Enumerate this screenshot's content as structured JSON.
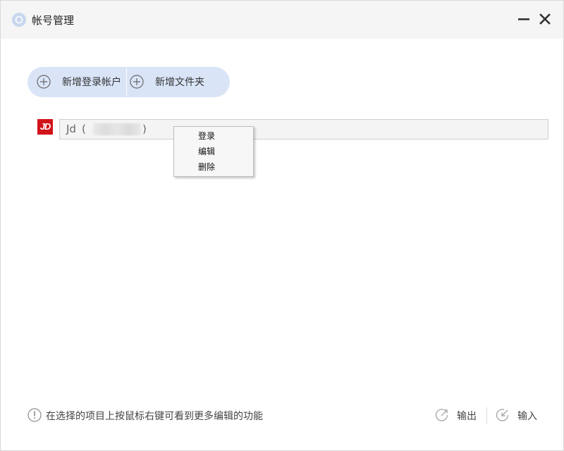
{
  "window": {
    "title": "帐号管理"
  },
  "toolbar": {
    "add_account_label": "新增登录帐户",
    "add_folder_label": "新增文件夹"
  },
  "accounts": [
    {
      "logo_text": "JD",
      "name": "Jd",
      "paren_open": "(",
      "paren_close": ")",
      "brand_color": "#d1131a"
    }
  ],
  "context_menu": {
    "items": [
      "登录",
      "编辑",
      "删除"
    ]
  },
  "footer": {
    "hint": "在选择的项目上按鼠标右键可看到更多编辑的功能",
    "export_label": "输出",
    "import_label": "输入"
  },
  "colors": {
    "toolbar_bg": "#d9e5f7",
    "titlebar_bg": "#f5f5f5"
  }
}
